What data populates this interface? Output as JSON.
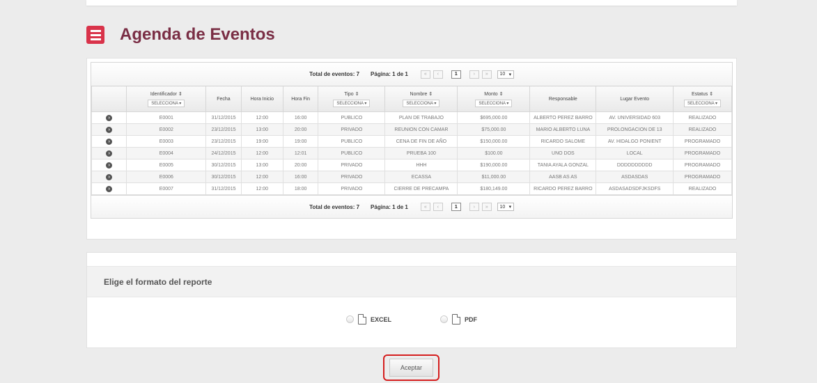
{
  "header": {
    "title": "Agenda de Eventos",
    "menu_icon": "hamburger-icon",
    "accent": "#d9334a",
    "title_color": "#7a2e45"
  },
  "paginator": {
    "total_label": "Total de eventos: 7",
    "page_label": "Página: 1 de 1",
    "first": "«",
    "prev": "‹",
    "current_page": "1",
    "next": "›",
    "last": "»",
    "rows_per_page": "10"
  },
  "table": {
    "columns": [
      {
        "label": "",
        "filter": ""
      },
      {
        "label": "Identificador ⇕",
        "filter": "SELECCIONA ▾"
      },
      {
        "label": "Fecha",
        "filter": ""
      },
      {
        "label": "Hora Inicio",
        "filter": ""
      },
      {
        "label": "Hora Fin",
        "filter": ""
      },
      {
        "label": "Tipo ⇕",
        "filter": "SELECCIONA ▾"
      },
      {
        "label": "Nombre ⇕",
        "filter": "SELECCIONA ▾"
      },
      {
        "label": "Monto ⇕",
        "filter": "SELECCIONA ▾"
      },
      {
        "label": "Responsable",
        "filter": ""
      },
      {
        "label": "Lugar Evento",
        "filter": ""
      },
      {
        "label": "Estatus ⇕",
        "filter": "SELECCIONA ▾"
      }
    ],
    "rows": [
      [
        "E0001",
        "31/12/2015",
        "12:00",
        "16:00",
        "PUBLICO",
        "PLAN DE TRABAJO",
        "$695,000.00",
        "ALBERTO PEREZ BARRO",
        "AV. UNIVERSIDAD 603",
        "REALIZADO"
      ],
      [
        "E0002",
        "23/12/2015",
        "13:00",
        "20:00",
        "PRIVADO",
        "REUNION CON CAMAR",
        "$75,000.00",
        "MARIO ALBERTO LUNA",
        "PROLONGACION DE 13",
        "REALIZADO"
      ],
      [
        "E0003",
        "23/12/2015",
        "19:00",
        "19:00",
        "PUBLICO",
        "CENA DE FIN DE AÑO",
        "$150,000.00",
        "RICARDO SALOME",
        "AV. HIDALGO PONIENT",
        "PROGRAMADO"
      ],
      [
        "E0004",
        "24/12/2015",
        "12:00",
        "12:01",
        "PUBLICO",
        "PRUEBA 100",
        "$100.00",
        "UNO DOS",
        "LOCAL",
        "PROGRAMADO"
      ],
      [
        "E0005",
        "30/12/2015",
        "13:00",
        "20:00",
        "PRIVADO",
        "HHH",
        "$190,000.00",
        "TANIA AYALA GONZAL",
        "DDDDDDDDDD",
        "PROGRAMADO"
      ],
      [
        "E0006",
        "30/12/2015",
        "12:00",
        "16:00",
        "PRIVADO",
        "ECASSA",
        "$11,000.00",
        "AASB AS AS",
        "ASDASDAS",
        "PROGRAMADO"
      ],
      [
        "E0007",
        "31/12/2015",
        "12:00",
        "18:00",
        "PRIVADO",
        "CIERRE DE PRECAMPA",
        "$180,149.00",
        "RICARDO PEREZ BARRO",
        "ASDASADSDFJKSDFS",
        "REALIZADO"
      ]
    ]
  },
  "report": {
    "title": "Elige el formato del reporte",
    "options": [
      {
        "label": "EXCEL",
        "icon": "excel-file-icon"
      },
      {
        "label": "PDF",
        "icon": "pdf-file-icon"
      }
    ]
  },
  "accept_button": {
    "label": "Aceptar",
    "highlight": "#d51e1e"
  }
}
